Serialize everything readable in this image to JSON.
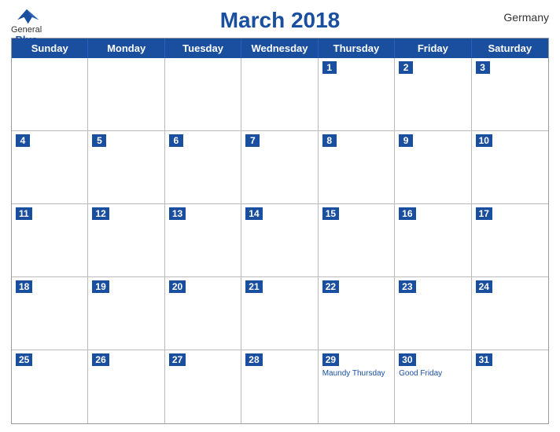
{
  "logo": {
    "general": "General",
    "blue": "Blue"
  },
  "title": "March 2018",
  "country": "Germany",
  "days_header": [
    "Sunday",
    "Monday",
    "Tuesday",
    "Wednesday",
    "Thursday",
    "Friday",
    "Saturday"
  ],
  "weeks": [
    [
      {
        "day": "",
        "holiday": ""
      },
      {
        "day": "",
        "holiday": ""
      },
      {
        "day": "",
        "holiday": ""
      },
      {
        "day": "",
        "holiday": ""
      },
      {
        "day": "1",
        "holiday": ""
      },
      {
        "day": "2",
        "holiday": ""
      },
      {
        "day": "3",
        "holiday": ""
      }
    ],
    [
      {
        "day": "4",
        "holiday": ""
      },
      {
        "day": "5",
        "holiday": ""
      },
      {
        "day": "6",
        "holiday": ""
      },
      {
        "day": "7",
        "holiday": ""
      },
      {
        "day": "8",
        "holiday": ""
      },
      {
        "day": "9",
        "holiday": ""
      },
      {
        "day": "10",
        "holiday": ""
      }
    ],
    [
      {
        "day": "11",
        "holiday": ""
      },
      {
        "day": "12",
        "holiday": ""
      },
      {
        "day": "13",
        "holiday": ""
      },
      {
        "day": "14",
        "holiday": ""
      },
      {
        "day": "15",
        "holiday": ""
      },
      {
        "day": "16",
        "holiday": ""
      },
      {
        "day": "17",
        "holiday": ""
      }
    ],
    [
      {
        "day": "18",
        "holiday": ""
      },
      {
        "day": "19",
        "holiday": ""
      },
      {
        "day": "20",
        "holiday": ""
      },
      {
        "day": "21",
        "holiday": ""
      },
      {
        "day": "22",
        "holiday": ""
      },
      {
        "day": "23",
        "holiday": ""
      },
      {
        "day": "24",
        "holiday": ""
      }
    ],
    [
      {
        "day": "25",
        "holiday": ""
      },
      {
        "day": "26",
        "holiday": ""
      },
      {
        "day": "27",
        "holiday": ""
      },
      {
        "day": "28",
        "holiday": ""
      },
      {
        "day": "29",
        "holiday": "Maundy Thursday"
      },
      {
        "day": "30",
        "holiday": "Good Friday"
      },
      {
        "day": "31",
        "holiday": ""
      }
    ]
  ]
}
